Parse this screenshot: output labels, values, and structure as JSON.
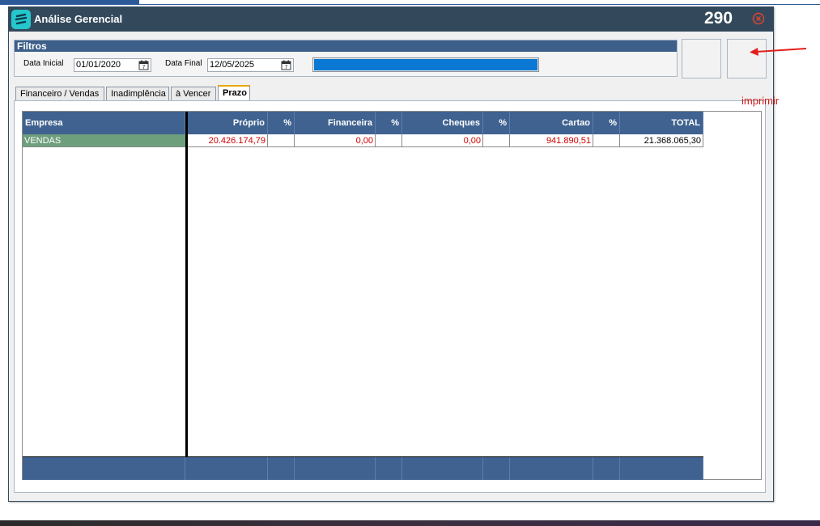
{
  "window": {
    "title": "Análise Gerencial",
    "record_count": "290",
    "icons": {
      "app": "app-logo-icon",
      "close": "close-circle-icon"
    }
  },
  "filters": {
    "title": "Filtros",
    "start_date_label": "Data Inicial",
    "start_date_value": "01/01/2020",
    "end_date_label": "Data Final",
    "end_date_value": "12/05/2025",
    "progress": 1.0
  },
  "tabs": [
    {
      "label": "Financeiro / Vendas",
      "active": false
    },
    {
      "label": "Inadimplência",
      "active": false
    },
    {
      "label": "à Vencer",
      "active": false
    },
    {
      "label": "Prazo",
      "active": true
    }
  ],
  "grid": {
    "columns": [
      "Empresa",
      "Próprio",
      "%",
      "Financeira",
      "%",
      "Cheques",
      "%",
      "Cartao",
      "%",
      "TOTAL"
    ],
    "rows": [
      [
        "VENDAS",
        "20.426.174,79",
        "",
        "0,00",
        "",
        "0,00",
        "",
        "941.890,51",
        "",
        "21.368.065,30"
      ]
    ]
  },
  "annotation": {
    "text": "imprimir",
    "color": "#d01a1a"
  },
  "colors": {
    "titlebar": "#33495b",
    "header": "#3f6290",
    "company_cell": "#6e9f7d",
    "value_text": "#d10000",
    "progress": "#0b78d4"
  }
}
